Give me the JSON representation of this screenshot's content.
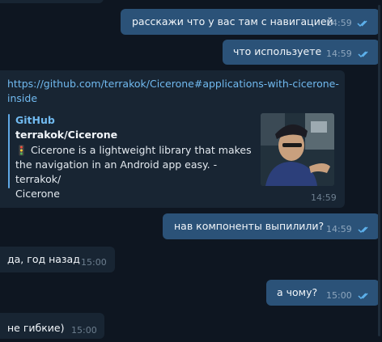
{
  "messages": [
    {
      "text": "расскажи что у вас там с навигацией",
      "time": "14:59"
    },
    {
      "text": "что используете",
      "time": "14:59"
    },
    {
      "link": "https://github.com/terrakok/Cicerone#applications-with-cicerone-inside",
      "link_line1": "https://github.com/terrakok/Cicerone#applications-with-cicerone-",
      "link_line2": "inside",
      "preview": {
        "site": "GitHub",
        "title": "terrakok/Cicerone",
        "emoji": "🚦",
        "desc_line1": "Cicerone is a lightweight library that makes",
        "desc_line2": "the navigation in an Android app easy. - terrakok/",
        "desc_line3": "Cicerone"
      },
      "time": "14:59"
    },
    {
      "text": "нав компоненты выпилили?",
      "time": "14:59"
    },
    {
      "text": "да, год назад",
      "time": "15:00"
    },
    {
      "text": "а чому?",
      "time": "15:00"
    },
    {
      "text": "не гибкие)",
      "time": "15:00"
    }
  ],
  "colors": {
    "background": "#0e1621",
    "outgoing": "#2b5278",
    "incoming": "#182533",
    "link": "#71baf0",
    "read_check": "#5fb4f0"
  },
  "icons": {
    "read_receipt": "double-check-icon",
    "traffic_light": "traffic-light-emoji"
  }
}
